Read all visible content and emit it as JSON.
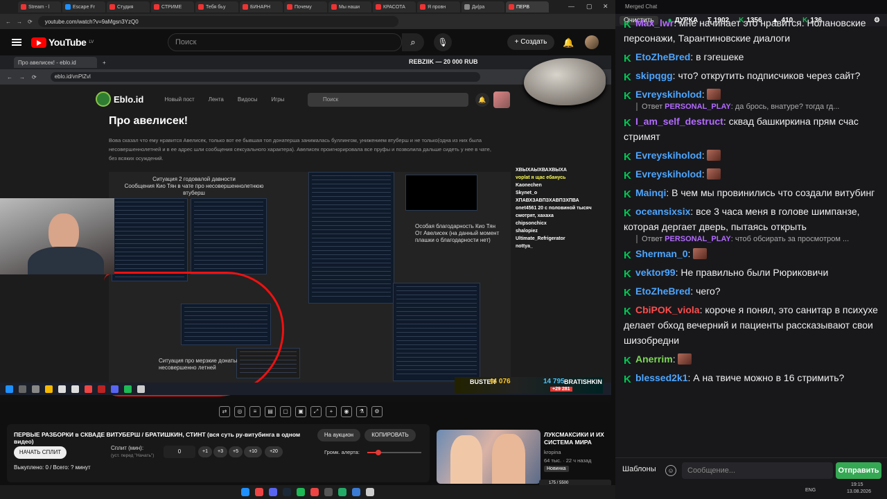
{
  "browser": {
    "tabs": [
      "Stream - l",
      "Escape Fr",
      "Студия",
      "СТРИМЕ",
      "Тебя бьу",
      "БИНАРН",
      "Почему",
      "Мы наши",
      "КРАСОТА",
      "Я провн",
      "Ди|ра",
      "ПЕРВ"
    ],
    "url": "youtube.com/watch?v=9aMgsn3YzQ0"
  },
  "youtube": {
    "logo": "YouTube",
    "region": "LV",
    "search_placeholder": "Поиск",
    "create_label": "Создать"
  },
  "inner_browser": {
    "tab_title": "Про авелисек! - eblo.id",
    "url": "eblo.id/vnPlZvl",
    "banner": "REBZIIK — 20 000 RUB"
  },
  "site": {
    "logo": "Eblo.id",
    "nav": [
      "Новый пост",
      "Лента",
      "Видосы",
      "Игры"
    ],
    "search_placeholder": "Поиск",
    "post_title": "Про авелисек!",
    "post_body": "Вова сказал что ему нравится Авелисек, только вот ее бывшая топ донатерша занималась буллингом, унижением втуберш и не только(одна из них была несовершеннолетней и в ее адрес шли сообщения сексуального характера). Авелисек проигнорировала все пруфы и позволила дальше сидеть у нее в чате, без всяких осуждений.",
    "annot1": "Ситуация 2 годовалой давности\nСообщения Кио Тян в чате про несовершеннолетнюю втуберш",
    "annot2": "Особая благодарность Кио Тян\nОт Авелисек (на данный момент плашки о благодарности нет)",
    "annot3": "Ситуация про мерзкие донаты\nнесовершенно летней"
  },
  "stream_overlay": {
    "lines": [
      "ХВЫХАЫХВАХВЫХА",
      "voplat я щас ебанусь",
      "Kaonechen",
      "Skynet_o",
      "ХПАВХЗАВПЗХАВПЗХПВА",
      "onet4561 20 с половиной тысяч смотрят, хахаха",
      "chipsonchicx",
      "shalopiez",
      "Ultimate_Refrigerator",
      "nottya_"
    ],
    "score_left_name": "BUSTER",
    "score_left": "44 076",
    "score_right": "14 795",
    "score_right_name": "BRATISHKIN",
    "score_delta": "+29 281"
  },
  "video": {
    "title": "ПЕРВЫЕ РАЗБОРКИ в СКВАДЕ ВИТУБЕРШ / БРАТИШКИН, СТИНТ (вся суть ру-витубинга в одном видео)",
    "auction_label": "На аукцион",
    "copy_label": "КОПИРОВАТЬ",
    "start_split_label": "НАЧАТЬ СПЛИТ",
    "split_label": "Сплит (мин):",
    "split_hint": "(уст. перед \"Начать\")",
    "split_value": "0",
    "increments": [
      "+1",
      "+3",
      "+5",
      "+10",
      "+20"
    ],
    "volume_label": "Громк. алерта:",
    "volume_level": 0.2,
    "bought_label": "Выкуплено: 0 / Всего: ? минут"
  },
  "recommended": {
    "title": "ЛУКСМАКСИКИ И ИХ СИСТЕМА МИРА",
    "channel": "kropina",
    "meta": "64 тыс. · 22 ч назад",
    "badge": "Новинка",
    "progress_label": "175 / 5500"
  },
  "chat": {
    "header": "Merged Chat",
    "clear_label": "Очистить",
    "channel": "ДУРКА",
    "stat1": "Σ 1902",
    "stat2": "1356",
    "stat3": "410",
    "stat4": "136",
    "messages": [
      {
        "user": "Max_lwr",
        "color": "#b36bff",
        "text": "мне начинает это нравится. Нолановские персонажи, Тарантиновские диалоги"
      },
      {
        "user": "EtoZheBred",
        "color": "#4da6ff",
        "text": "в гэгешеке"
      },
      {
        "user": "skipqgg",
        "color": "#4da6ff",
        "text": "что? открутить подписчиков через сайт?"
      },
      {
        "user": "Evreyskiholod",
        "color": "#4da6ff",
        "text": ""
      },
      {
        "reply_user": "PERSONAL_PLAY",
        "reply_text": "да брось, внатуре? тогда гд..."
      },
      {
        "user": "I_am_self_destruct",
        "color": "#b36bff",
        "text": "сквад башкиркина прям счас стримят"
      },
      {
        "user": "Evreyskiholod",
        "color": "#4da6ff",
        "text": ""
      },
      {
        "user": "Evreyskiholod",
        "color": "#4da6ff",
        "text": ""
      },
      {
        "user": "Mainqi",
        "color": "#4da6ff",
        "text": "В чем мы провинились что создали витубинг"
      },
      {
        "user": "oceansixsix",
        "color": "#4da6ff",
        "text": "все 3 часа меня в голове шимпанзе, которая дергает дверь, пытаясь открыть"
      },
      {
        "reply_user": "PERSONAL_PLAY",
        "reply_text": "чтоб обсирать за просмотром ..."
      },
      {
        "user": "Sherman_0",
        "color": "#4da6ff",
        "text": ""
      },
      {
        "user": "vektor99",
        "color": "#4da6ff",
        "text": "Не правильно были Рюриковичи"
      },
      {
        "user": "EtoZheBred",
        "color": "#4da6ff",
        "text": "чего?"
      },
      {
        "user": "CbiPOK_viola",
        "color": "#ff4d4d",
        "text": "короче я понял, это санитар в психухе делает обход вечерний и пациенты рассказывают свои шизобредни"
      },
      {
        "user": "Anerrim",
        "color": "#7ed957",
        "text": ""
      },
      {
        "user": "blessed2k1",
        "color": "#4da6ff",
        "text": "А на твиче можно в 16 стримить?"
      }
    ],
    "templates_label": "Шаблоны",
    "input_placeholder": "Сообщение...",
    "send_label": "Отправить",
    "sys_lang": "ENG",
    "time": "19:15",
    "date": "13.08.2026"
  },
  "colors": {
    "accent": "#ff0000",
    "send": "#34a853",
    "chat_bg": "#18181b",
    "kick_green": "#00c853"
  }
}
